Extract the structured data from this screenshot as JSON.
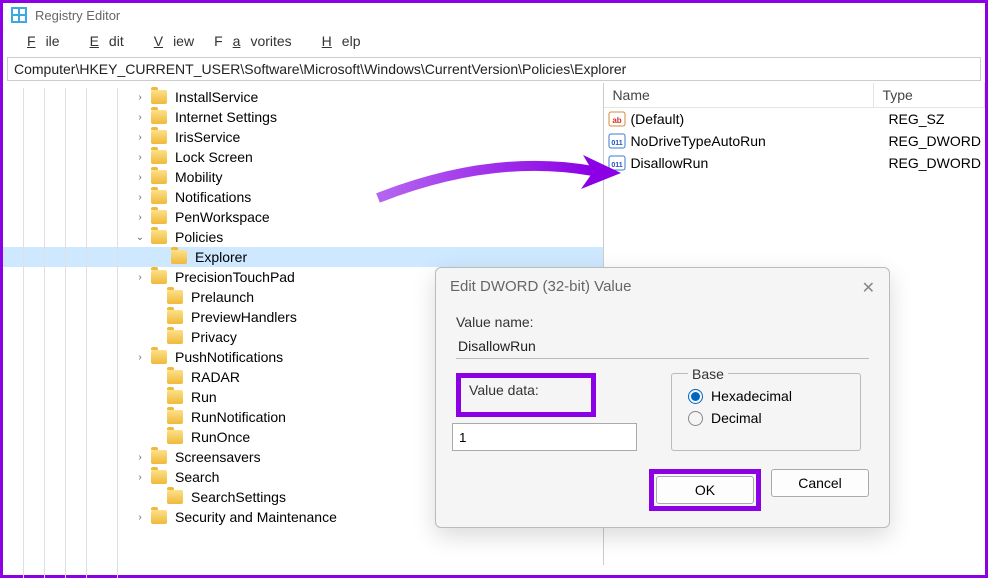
{
  "window_title": "Registry Editor",
  "menu": {
    "file": "File",
    "edit": "Edit",
    "view": "View",
    "favorites": "Favorites",
    "help": "Help"
  },
  "address": "Computer\\HKEY_CURRENT_USER\\Software\\Microsoft\\Windows\\CurrentVersion\\Policies\\Explorer",
  "tree": [
    {
      "label": "InstallService",
      "indent": 130,
      "chev": "›"
    },
    {
      "label": "Internet Settings",
      "indent": 130,
      "chev": "›"
    },
    {
      "label": "IrisService",
      "indent": 130,
      "chev": "›"
    },
    {
      "label": "Lock Screen",
      "indent": 130,
      "chev": "›"
    },
    {
      "label": "Mobility",
      "indent": 130,
      "chev": "›"
    },
    {
      "label": "Notifications",
      "indent": 130,
      "chev": "›"
    },
    {
      "label": "PenWorkspace",
      "indent": 130,
      "chev": "›"
    },
    {
      "label": "Policies",
      "indent": 130,
      "chev": "⌄"
    },
    {
      "label": "Explorer",
      "indent": 150,
      "chev": "",
      "selected": true
    },
    {
      "label": "PrecisionTouchPad",
      "indent": 130,
      "chev": "›"
    },
    {
      "label": "Prelaunch",
      "indent": 146,
      "chev": ""
    },
    {
      "label": "PreviewHandlers",
      "indent": 146,
      "chev": ""
    },
    {
      "label": "Privacy",
      "indent": 146,
      "chev": ""
    },
    {
      "label": "PushNotifications",
      "indent": 130,
      "chev": "›"
    },
    {
      "label": "RADAR",
      "indent": 146,
      "chev": ""
    },
    {
      "label": "Run",
      "indent": 146,
      "chev": ""
    },
    {
      "label": "RunNotification",
      "indent": 146,
      "chev": ""
    },
    {
      "label": "RunOnce",
      "indent": 146,
      "chev": ""
    },
    {
      "label": "Screensavers",
      "indent": 130,
      "chev": "›"
    },
    {
      "label": "Search",
      "indent": 130,
      "chev": "›"
    },
    {
      "label": "SearchSettings",
      "indent": 146,
      "chev": ""
    },
    {
      "label": "Security and Maintenance",
      "indent": 130,
      "chev": "›"
    }
  ],
  "list_header": {
    "name": "Name",
    "type": "Type"
  },
  "list_items": [
    {
      "name": "(Default)",
      "type": "REG_SZ",
      "icon": "str"
    },
    {
      "name": "NoDriveTypeAutoRun",
      "type": "REG_DWORD",
      "icon": "bin"
    },
    {
      "name": "DisallowRun",
      "type": "REG_DWORD",
      "icon": "bin"
    }
  ],
  "dialog": {
    "title": "Edit DWORD (32-bit) Value",
    "value_name_label": "Value name:",
    "value_name": "DisallowRun",
    "value_data_label": "Value data:",
    "value_data": "1",
    "base_label": "Base",
    "hex": "Hexadecimal",
    "dec": "Decimal",
    "ok": "OK",
    "cancel": "Cancel"
  }
}
